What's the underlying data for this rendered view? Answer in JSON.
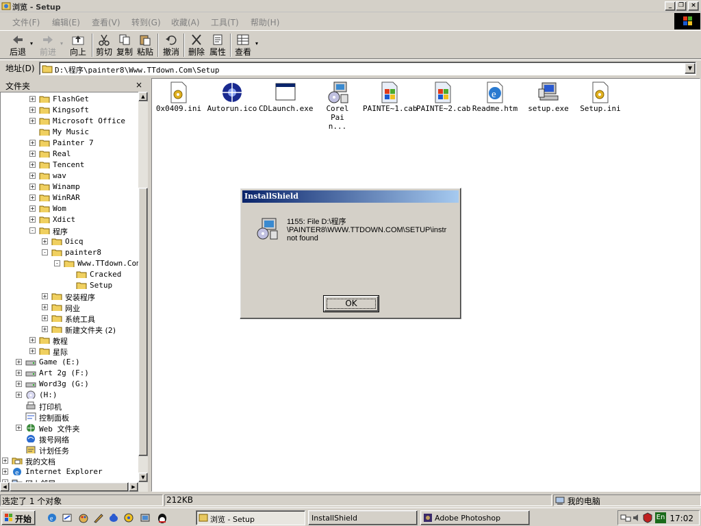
{
  "window": {
    "title": "浏览 - Setup"
  },
  "menu": [
    "文件(F)",
    "编辑(E)",
    "查看(V)",
    "转到(G)",
    "收藏(A)",
    "工具(T)",
    "帮助(H)"
  ],
  "toolbar": {
    "back": "后退",
    "forward": "前进",
    "up": "向上",
    "cut": "剪切",
    "copy": "复制",
    "paste": "粘贴",
    "undo": "撤消",
    "delete": "删除",
    "properties": "属性",
    "views": "查看"
  },
  "address": {
    "label": "地址(D)",
    "value": "D:\\程序\\painter8\\Www.TTdown.Com\\Setup"
  },
  "folders": {
    "title": "文件夹",
    "close": "×",
    "tree": [
      {
        "label": "FlashGet",
        "pm": "+"
      },
      {
        "label": "Kingsoft",
        "pm": "+"
      },
      {
        "label": "Microsoft Office",
        "pm": "+"
      },
      {
        "label": "My Music",
        "pm": ""
      },
      {
        "label": "Painter 7",
        "pm": "+"
      },
      {
        "label": "Real",
        "pm": "+"
      },
      {
        "label": "Tencent",
        "pm": "+"
      },
      {
        "label": "wav",
        "pm": "+"
      },
      {
        "label": "Winamp",
        "pm": "+"
      },
      {
        "label": "WinRAR",
        "pm": "+"
      },
      {
        "label": "Wom",
        "pm": "+"
      },
      {
        "label": "Xdict",
        "pm": "+"
      },
      {
        "label": "程序",
        "pm": "-"
      },
      {
        "label": "Oicq",
        "pm": "+"
      },
      {
        "label": "painter8",
        "pm": "-"
      },
      {
        "label": "Www.TTdown.Com",
        "pm": "-"
      },
      {
        "label": "Cracked",
        "pm": ""
      },
      {
        "label": "Setup",
        "pm": ""
      },
      {
        "label": "安装程序",
        "pm": "+"
      },
      {
        "label": "网业",
        "pm": "+"
      },
      {
        "label": "系统工具",
        "pm": "+"
      },
      {
        "label": "新建文件夹 (2)",
        "pm": "+"
      },
      {
        "label": "教程",
        "pm": "+"
      },
      {
        "label": "星际",
        "pm": "+"
      },
      {
        "label": "Game (E:)",
        "pm": "+"
      },
      {
        "label": "Art 2g (F:)",
        "pm": "+"
      },
      {
        "label": "Word3g (G:)",
        "pm": "+"
      },
      {
        "label": "(H:)",
        "pm": "+"
      },
      {
        "label": "打印机",
        "pm": ""
      },
      {
        "label": "控制面板",
        "pm": ""
      },
      {
        "label": "Web 文件夹",
        "pm": "+"
      },
      {
        "label": "拨号网络",
        "pm": ""
      },
      {
        "label": "计划任务",
        "pm": ""
      },
      {
        "label": "我的文档",
        "pm": "+"
      },
      {
        "label": "Internet Explorer",
        "pm": "+"
      },
      {
        "label": "网上邻居",
        "pm": "+"
      }
    ]
  },
  "files": [
    {
      "name": "0x0409.ini",
      "icon": "ini-file-icon"
    },
    {
      "name": "Autorun.ico",
      "icon": "ico-file-icon"
    },
    {
      "name": "CDLaunch.exe",
      "icon": "window-exe-icon"
    },
    {
      "name": "Corel Pain...",
      "icon": "installer-icon"
    },
    {
      "name": "PAINTE~1.cab",
      "icon": "cab-file-icon"
    },
    {
      "name": "PAINTE~2.cab",
      "icon": "cab-file-icon"
    },
    {
      "name": "Readme.htm",
      "icon": "ie-document-icon"
    },
    {
      "name": "setup.exe",
      "icon": "setup-computer-icon"
    },
    {
      "name": "Setup.ini",
      "icon": "ini-file-icon"
    }
  ],
  "dialog": {
    "title": "InstallShield",
    "message_lines": [
      "1155: File D:\\程序",
      "\\PAINTER8\\WWW.TTDOWN.COM\\SETUP\\instr",
      "not found"
    ],
    "ok": "OK"
  },
  "status": {
    "objects": "选定了 1 个对象",
    "size": "212KB",
    "location": "我的电脑"
  },
  "taskbar": {
    "start": "开始",
    "tasks": [
      "浏览 - Setup",
      "InstallShield",
      "Adobe Photoshop"
    ],
    "clock": "17:02",
    "lang": "En"
  },
  "colors": {
    "dialog_title_start": "#0a246a",
    "dialog_title_end": "#a6caf0",
    "chrome": "#d4d0c8"
  }
}
